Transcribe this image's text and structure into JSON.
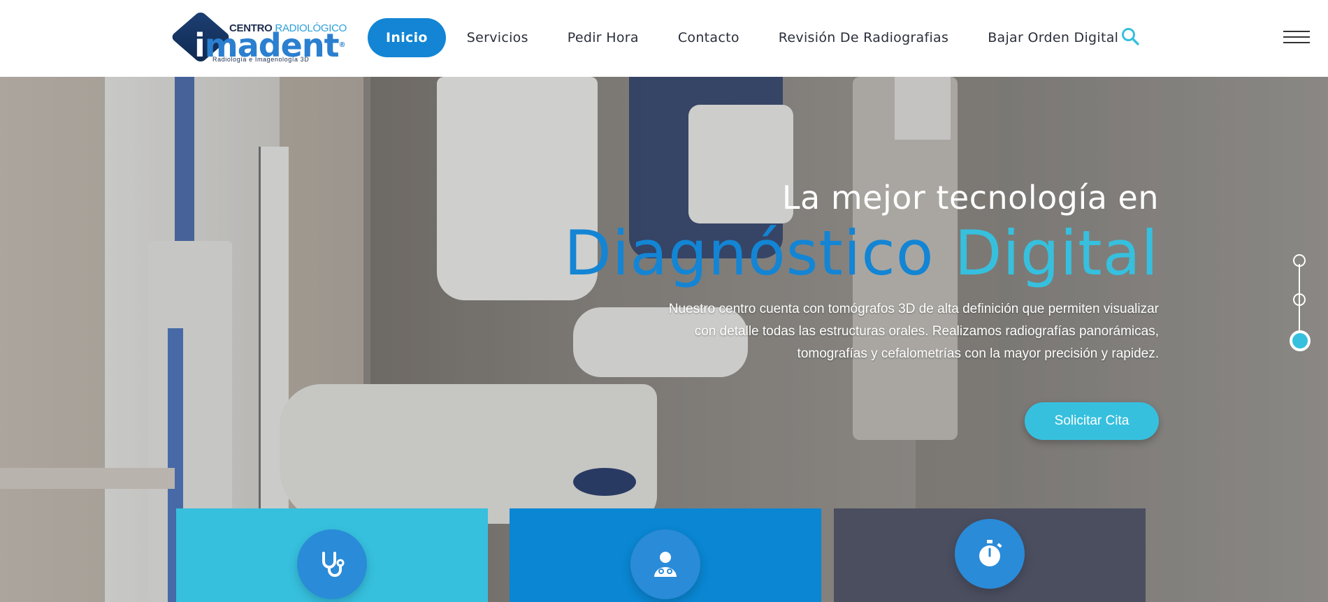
{
  "header": {
    "logo": {
      "line1_a": "CENTRO",
      "line1_b": "RADIOLÓGICO",
      "name_i": "i",
      "name_rest": "madent",
      "registered": "®",
      "tagline": "Radiología e Imagenología 3D"
    },
    "nav": [
      {
        "label": "Inicio",
        "active": true
      },
      {
        "label": "Servicios",
        "active": false
      },
      {
        "label": "Pedir Hora",
        "active": false
      },
      {
        "label": "Contacto",
        "active": false
      },
      {
        "label": "Revisión De Radiografias",
        "active": false
      },
      {
        "label": "Bajar Orden Digital",
        "active": false
      }
    ],
    "search_icon": "search-icon",
    "menu_icon": "hamburger-menu-icon"
  },
  "hero": {
    "line1": "La mejor tecnología en",
    "line2_word1": "Diagnóstico",
    "line2_word2": "Digital",
    "description_1": "Nuestro centro cuenta con tomógrafos 3D de alta definición que permiten visualizar",
    "description_2": "con detalle todas las estructuras orales. Realizamos radiografías panorámicas,",
    "description_3": "tomografías y cefalometrías con la mayor precisión y rapidez.",
    "cta_label": "Solicitar Cita",
    "slider_pager": {
      "count": 3,
      "active_index": 2
    }
  },
  "cards": [
    {
      "icon": "stethoscope-icon",
      "color": "#36c0de"
    },
    {
      "icon": "doctor-icon",
      "color": "#0a86d2"
    },
    {
      "icon": "stopwatch-icon",
      "color": "#4a4e5f"
    }
  ],
  "colors": {
    "primary": "#1385d4",
    "accent": "#36c0de",
    "dark": "#4a4e5f"
  }
}
